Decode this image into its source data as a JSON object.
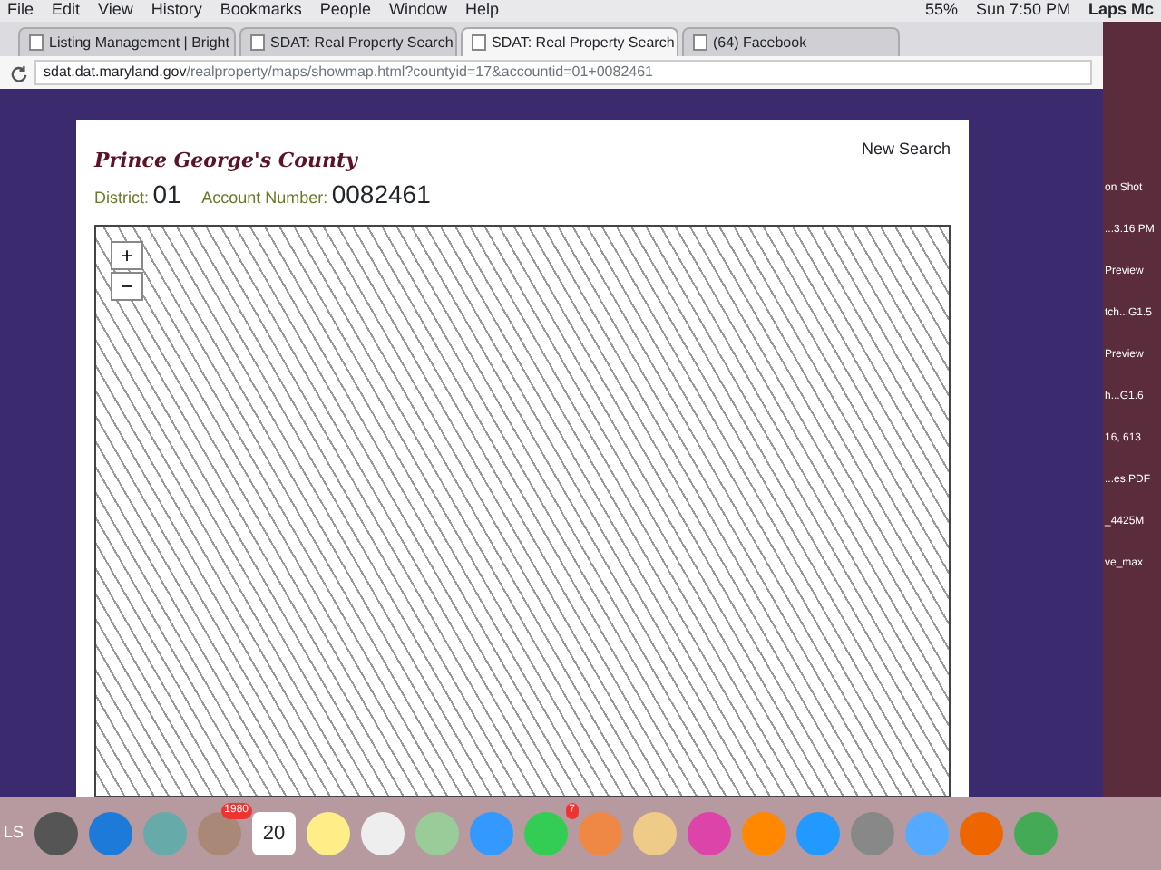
{
  "menu_bar": {
    "items": [
      "File",
      "Edit",
      "View",
      "History",
      "Bookmarks",
      "People",
      "Window",
      "Help"
    ],
    "battery": "55%",
    "clock": "Sun 7:50 PM",
    "user": "Laps Mc"
  },
  "tabs": [
    {
      "label": "Listing Management | Bright",
      "selected": false
    },
    {
      "label": "SDAT: Real Property Search",
      "selected": false
    },
    {
      "label": "SDAT: Real Property Search",
      "selected": true
    },
    {
      "label": "(64) Facebook",
      "selected": false
    }
  ],
  "address": {
    "host": "sdat.dat.maryland.gov",
    "path": "/realproperty/maps/showmap.html?countyid=17&accountid=01+0082461"
  },
  "page": {
    "county": "Prince George's County",
    "new_search": "New Search",
    "district_label": "District:",
    "district": "01",
    "account_label": "Account Number:",
    "account": "0082461",
    "zoom_in": "+",
    "zoom_out": "−"
  },
  "desktop_labels": [
    "on Shot",
    "...3.16 PM",
    "Preview",
    "tch...G1.5",
    "Preview",
    "h...G1.6",
    "16, 613",
    "...es.PDF",
    "_4425M",
    "ve_max"
  ],
  "dock": {
    "edge_label": "LS",
    "calendar_day": "20",
    "badges": [
      "1980",
      "7"
    ]
  }
}
